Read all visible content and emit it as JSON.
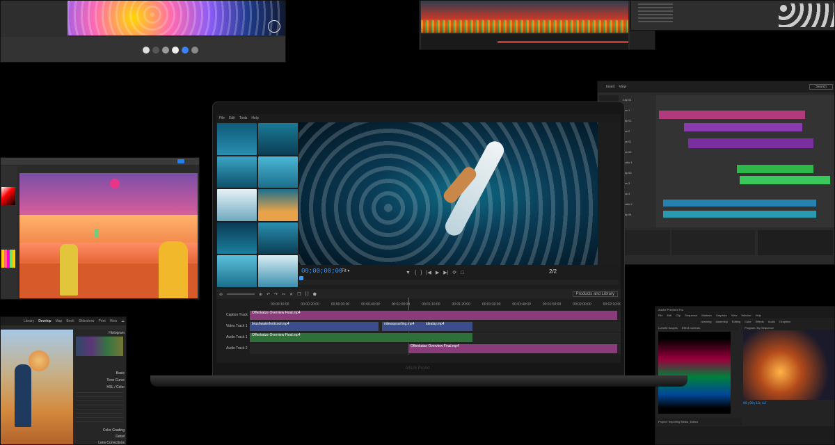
{
  "laptop": {
    "brand": "ASUS ProArt",
    "menu": [
      "File",
      "Edit",
      "Tools",
      "Help"
    ],
    "preview": {
      "timecode": "00;00;00;00",
      "fit": "Fit",
      "page": "2/2"
    },
    "toolbar": {
      "products": "Products and Library"
    },
    "ruler": [
      "00:00:10:00",
      "00:00:20:00",
      "00:00:30:00",
      "00:00:40:00",
      "00:01:00:00",
      "00:01:10:00",
      "00:01:20:00",
      "00:01:30:00",
      "00:01:40:00",
      "00:01:50:00",
      "00:02:00:00",
      "00:02:10:00",
      "00:02:20:00",
      "00:02:30:00"
    ],
    "tracks": [
      {
        "label": "Caption Track",
        "clip": "Offenkatze Overview Final.mp4",
        "color": "#8a3b7a"
      },
      {
        "label": "Video Track 1",
        "clip": "brushwaterfordcool.mp4",
        "color": "#3b4d8a"
      },
      {
        "label": "Audio Track 1",
        "clip": "Offenkatze Overview Final.mp4",
        "color": "#2f6f3a"
      },
      {
        "label": "Audio Track 2",
        "clip": "Offenkatze Overview Final.mp4",
        "color": "#8a3b7a"
      }
    ],
    "video_clips": [
      "brushwaterfordcool.mp4",
      "ridewaysurfing.mp4",
      "idealay.mp4"
    ]
  },
  "photo_editor": {
    "tabs": [
      "Library",
      "Develop",
      "Map",
      "Book",
      "Slideshow",
      "Print",
      "Web"
    ],
    "panels": [
      "Histogram",
      "Basic",
      "Tone Curve",
      "HSL / Color",
      "Color Grading",
      "Detail",
      "Lens Corrections"
    ]
  },
  "daw": {
    "tabs": [
      "Insert",
      "View"
    ],
    "search": "Search",
    "tracks": [
      "Clip 01",
      "Bus 1",
      "Clip 02",
      "Bus 2",
      "Bus 01",
      "Bus 02",
      "Audio 1",
      "Clip 03",
      "Bus 3",
      "Bus 4",
      "Audio 2",
      "Clip 04"
    ]
  },
  "pro_video": {
    "app_title": "Adobe Premiere Pro",
    "menu": [
      "File",
      "Edit",
      "Clip",
      "Sequence",
      "Markers",
      "Graphics",
      "View",
      "Window",
      "Help"
    ],
    "workspaces": [
      "Learning",
      "Assembly",
      "Editing",
      "Color",
      "Effects",
      "Audio",
      "Graphics"
    ],
    "panels": [
      "Lumetri Scopes",
      "Effect Controls",
      "Program: My Sequence"
    ],
    "project": "Project: Importing Media_Edited",
    "timecode": "00;00;13;12"
  }
}
